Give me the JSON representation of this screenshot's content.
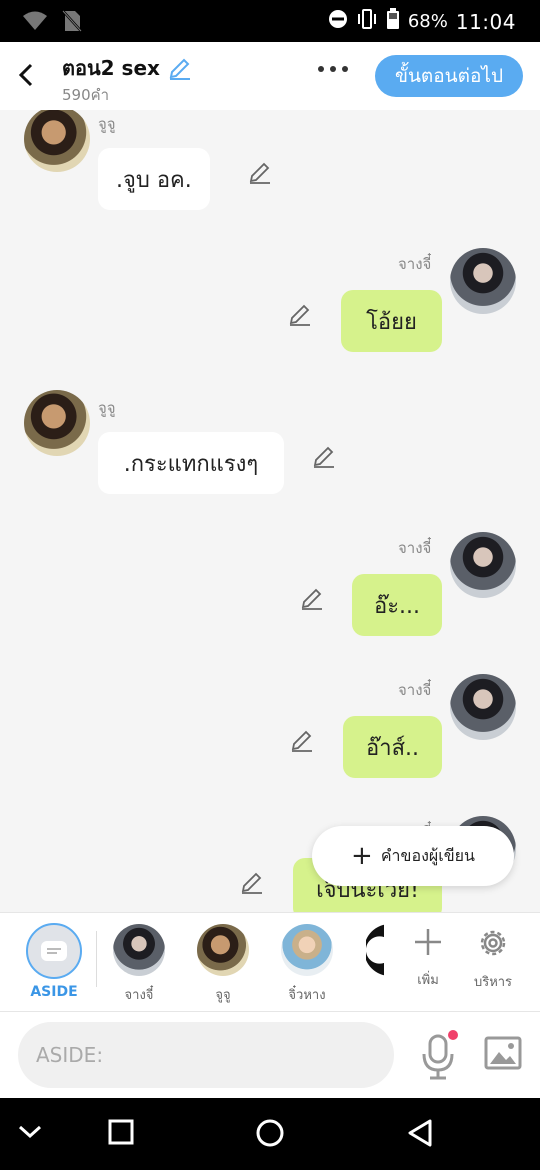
{
  "status_bar": {
    "battery": "68%",
    "time": "11:04"
  },
  "header": {
    "title": "ตอน2 sex",
    "word_count": "590คำ",
    "next_button": "ขั้นตอนต่อไป"
  },
  "messages": [
    {
      "name": "จูจู",
      "text": ".จูบ อค.",
      "side": "left"
    },
    {
      "name": "จางจี๋",
      "text": "โอ้ยย",
      "side": "right"
    },
    {
      "name": "จูจู",
      "text": ".กระแทกแรงๆ",
      "side": "left"
    },
    {
      "name": "จางจี๋",
      "text": "อ๊ะ...",
      "side": "right"
    },
    {
      "name": "จางจี๋",
      "text": "อ๊าส์..",
      "side": "right"
    },
    {
      "name": "จางจี๋",
      "text": "เจ็บนะเว่ย!",
      "side": "right"
    }
  ],
  "writer_note_button": "คำของผู้เขียน",
  "character_bar": {
    "aside_label": "ASIDE",
    "characters": [
      "จางจี๋",
      "จูจู",
      "จิ๋วหาง"
    ],
    "add_label": "เพิ่ม",
    "manage_label": "บริหาร"
  },
  "input": {
    "placeholder": "ASIDE:"
  },
  "colors": {
    "accent": "#5aabf1",
    "right_bubble": "#d6f28c",
    "left_bubble": "#ffffff",
    "background": "#f5f5f5"
  },
  "icons": [
    "wifi-icon",
    "no-sim-icon",
    "do-not-disturb-icon",
    "vibrate-icon",
    "battery-icon",
    "back-arrow-icon",
    "edit-pencil-icon",
    "more-options-icon",
    "plus-icon",
    "gear-icon",
    "microphone-icon",
    "image-icon",
    "nav-back-icon",
    "nav-home-icon",
    "nav-recents-icon",
    "nav-collapse-icon"
  ]
}
